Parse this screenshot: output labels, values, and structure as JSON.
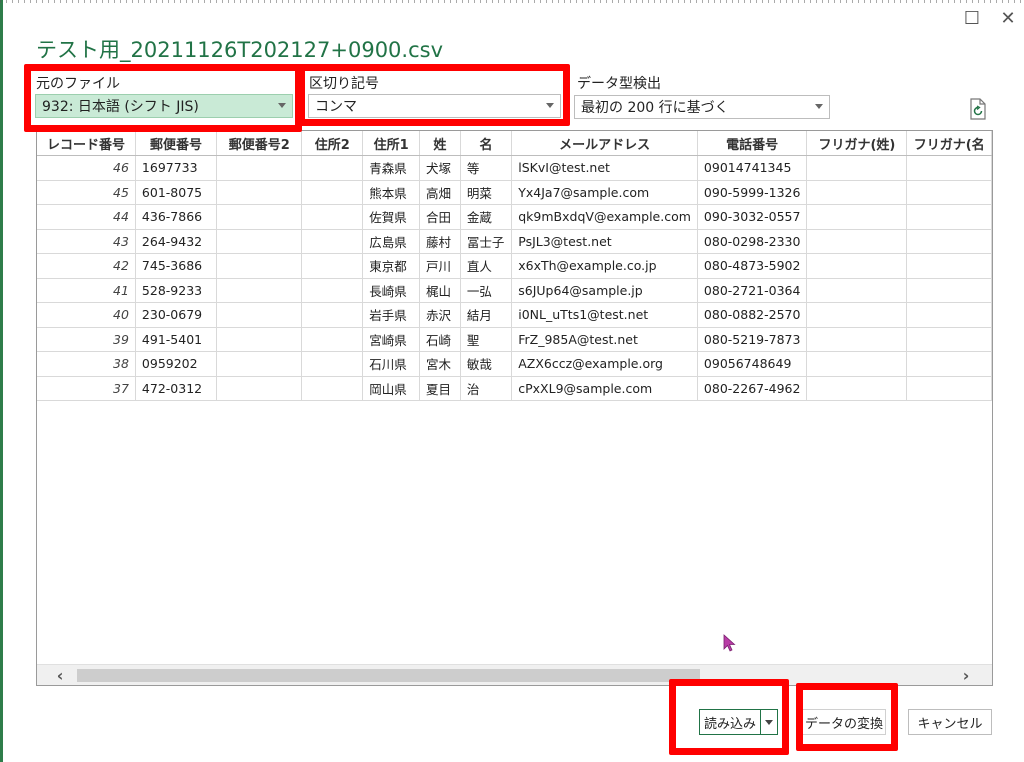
{
  "window": {
    "title": "テスト用_20211126T202127+0900.csv",
    "maximize_glyph": "☐",
    "close_glyph": "✕"
  },
  "controls": {
    "file_origin": {
      "label": "元のファイル",
      "value": "932: 日本語 (シフト JIS)"
    },
    "delimiter": {
      "label": "区切り記号",
      "value": "コンマ"
    },
    "datatype": {
      "label": "データ型検出",
      "value": "最初の 200 行に基づく"
    }
  },
  "table": {
    "columns": [
      "レコード番号",
      "郵便番号",
      "郵便番号2",
      "住所2",
      "住所1",
      "姓",
      "名",
      "メールアドレス",
      "電話番号",
      "フリガナ(姓)",
      "フリガナ(名"
    ],
    "rows": [
      [
        "46",
        "1697733",
        "",
        "",
        "青森県",
        "犬塚",
        "等",
        "lSKvI@test.net",
        "09014741345",
        "",
        ""
      ],
      [
        "45",
        "601-8075",
        "",
        "",
        "熊本県",
        "高畑",
        "明菜",
        "Yx4Ja7@sample.com",
        "090-5999-1326",
        "",
        ""
      ],
      [
        "44",
        "436-7866",
        "",
        "",
        "佐賀県",
        "合田",
        "金蔵",
        "qk9mBxdqV@example.com",
        "090-3032-0557",
        "",
        ""
      ],
      [
        "43",
        "264-9432",
        "",
        "",
        "広島県",
        "藤村",
        "冨士子",
        "PsJL3@test.net",
        "080-0298-2330",
        "",
        ""
      ],
      [
        "42",
        "745-3686",
        "",
        "",
        "東京都",
        "戸川",
        "直人",
        "x6xTh@example.co.jp",
        "080-4873-5902",
        "",
        ""
      ],
      [
        "41",
        "528-9233",
        "",
        "",
        "長崎県",
        "梶山",
        "一弘",
        "s6JUp64@sample.jp",
        "080-2721-0364",
        "",
        ""
      ],
      [
        "40",
        "230-0679",
        "",
        "",
        "岩手県",
        "赤沢",
        "結月",
        "i0NL_uTts1@test.net",
        "080-0882-2570",
        "",
        ""
      ],
      [
        "39",
        "491-5401",
        "",
        "",
        "宮崎県",
        "石崎",
        "聖",
        "FrZ_985A@test.net",
        "080-5219-7873",
        "",
        ""
      ],
      [
        "38",
        "0959202",
        "",
        "",
        "石川県",
        "宮木",
        "敏哉",
        "AZX6ccz@example.org",
        "09056748649",
        "",
        ""
      ],
      [
        "37",
        "472-0312",
        "",
        "",
        "岡山県",
        "夏目",
        "治",
        "cPxXL9@sample.com",
        "080-2267-4962",
        "",
        ""
      ]
    ]
  },
  "scrollbar": {
    "left_glyph": "‹",
    "right_glyph": "›"
  },
  "buttons": {
    "load": "読み込み",
    "transform": "データの変換",
    "cancel": "キャンセル"
  },
  "colors": {
    "title_green": "#217346",
    "highlight_red": "#ff0000",
    "selected_combo": "#c9ead6"
  }
}
